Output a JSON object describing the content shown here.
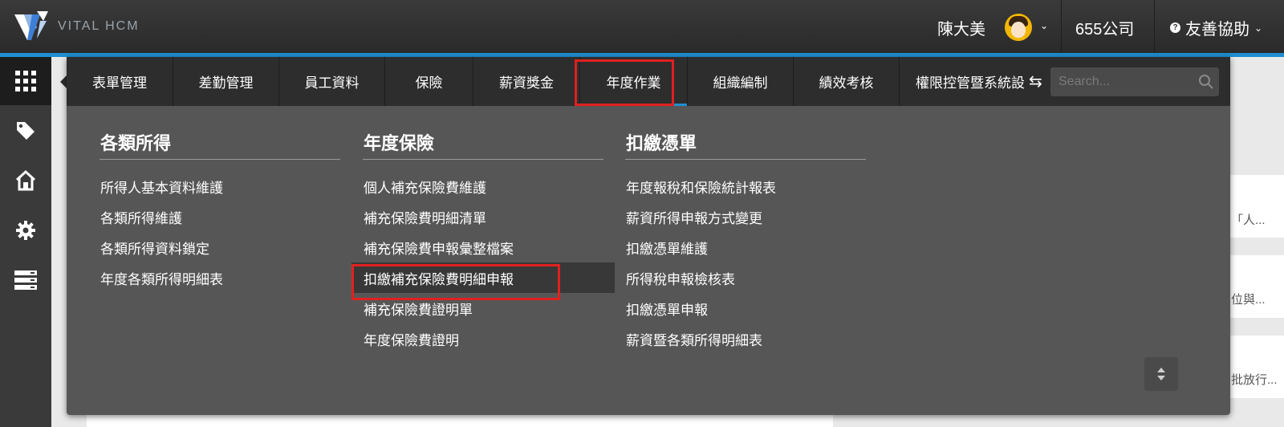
{
  "app": {
    "logo_text": "VITAL HCM"
  },
  "header": {
    "user_name": "陳大美",
    "company": "655公司",
    "help_label": "友善協助"
  },
  "sidebar": {
    "icons": [
      "apps-grid-icon",
      "tag-icon",
      "home-icon",
      "gear-icon",
      "server-icon"
    ]
  },
  "menu": {
    "tabs": [
      {
        "label": "表單管理"
      },
      {
        "label": "差勤管理"
      },
      {
        "label": "員工資料"
      },
      {
        "label": "保險"
      },
      {
        "label": "薪資獎金"
      },
      {
        "label": "年度作業",
        "active": true
      },
      {
        "label": "組織編制"
      },
      {
        "label": "績效考核"
      },
      {
        "label": "權限控管暨系統設定"
      }
    ],
    "search": {
      "placeholder": "Search..."
    },
    "columns": [
      {
        "title": "各類所得",
        "items": [
          "所得人基本資料維護",
          "各類所得維護",
          "各類所得資料鎖定",
          "年度各類所得明細表"
        ]
      },
      {
        "title": "年度保險",
        "items": [
          "個人補充保險費維護",
          "補充保險費明細清單",
          "補充保險費申報彙整檔案",
          "扣繳補充保險費明細申報",
          "補充保險費證明單",
          "年度保險費證明"
        ],
        "highlighted_item": "扣繳補充保險費明細申報"
      },
      {
        "title": "扣繳憑單",
        "items": [
          "年度報稅和保險統計報表",
          "薪資所得申報方式變更",
          "扣繳憑單維護",
          "所得稅申報檢核表",
          "扣繳憑單申報",
          "薪資暨各類所得明細表"
        ]
      }
    ]
  },
  "background": {
    "snippets": [
      "「人...",
      "位與...",
      "批放行..."
    ]
  },
  "colors": {
    "accent_blue": "#1f8fd1",
    "highlight_red": "#e0211f",
    "menu_bg": "#565656",
    "tabbar_bg": "#2d2d2d"
  }
}
